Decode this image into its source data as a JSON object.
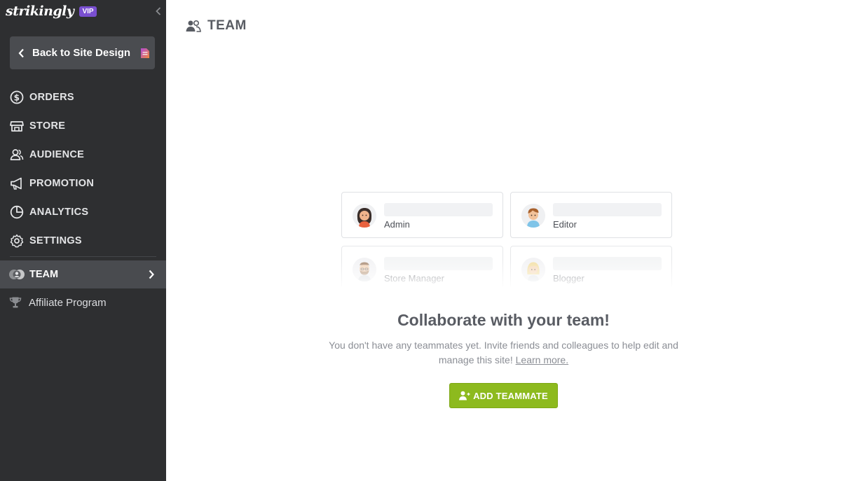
{
  "brand": {
    "name": "strikingly",
    "badge": "VIP"
  },
  "sidebar": {
    "back_label": "Back to Site Design",
    "items": [
      {
        "label": "ORDERS",
        "icon": "dollar-circle-icon"
      },
      {
        "label": "STORE",
        "icon": "storefront-icon"
      },
      {
        "label": "AUDIENCE",
        "icon": "people-icon"
      },
      {
        "label": "PROMOTION",
        "icon": "megaphone-icon"
      },
      {
        "label": "ANALYTICS",
        "icon": "pie-chart-icon"
      },
      {
        "label": "SETTINGS",
        "icon": "gear-icon"
      }
    ],
    "active": {
      "label": "TEAM",
      "icon": "team-icon"
    },
    "affiliate": {
      "label": "Affiliate Program",
      "icon": "trophy-icon"
    }
  },
  "main": {
    "title": "TEAM",
    "cards": [
      {
        "role": "Admin"
      },
      {
        "role": "Editor"
      },
      {
        "role": "Store Manager"
      },
      {
        "role": "Blogger"
      }
    ],
    "headline": "Collaborate with your team!",
    "subtext": "You don't have any teammates yet. Invite friends and colleagues to help edit and manage this site!",
    "learn_more": "Learn more.",
    "add_button": "ADD TEAMMATE"
  },
  "colors": {
    "sidebar_bg": "#2e2f31",
    "active_bg": "#494b4f",
    "accent_green": "#8dba1e",
    "vip_purple": "#7a4fd1"
  }
}
